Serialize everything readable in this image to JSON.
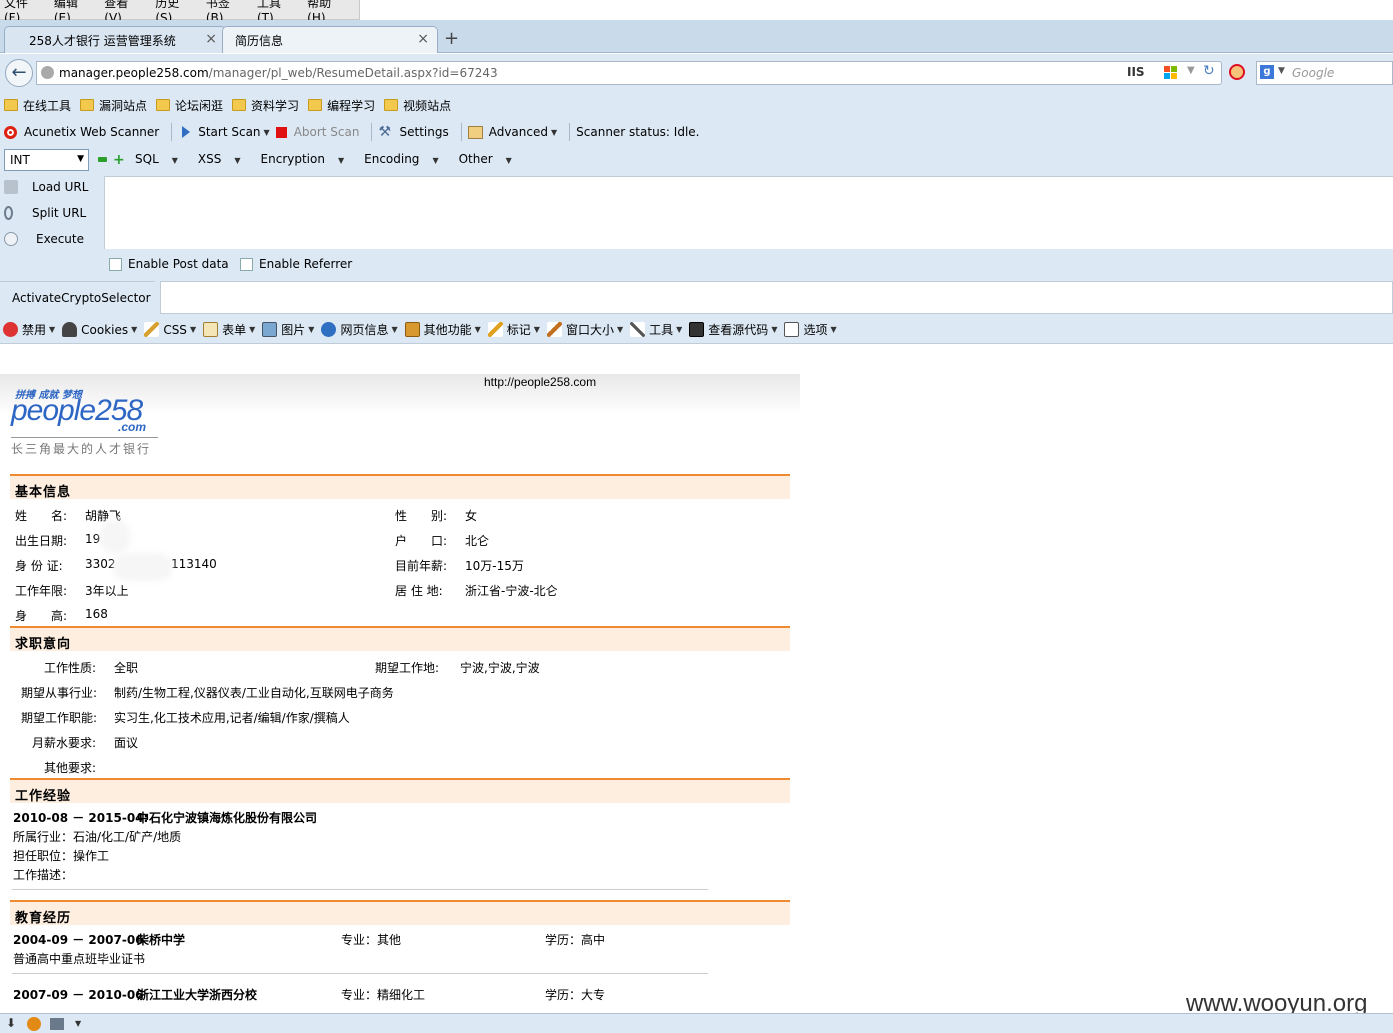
{
  "menu": [
    "文件(F)",
    "编辑(E)",
    "查看(V)",
    "历史(S)",
    "书签(B)",
    "工具(T)",
    "帮助(H)"
  ],
  "tabs": [
    {
      "label": "258人才银行 运营管理系统",
      "close": "×"
    },
    {
      "label": "简历信息",
      "close": "×"
    }
  ],
  "new_tab": "+",
  "nav": {
    "url_host": "manager.people258.com",
    "url_path": "/manager/pl_web/ResumeDetail.aspx?id=67243",
    "url_prefix": "",
    "iis": "IIS",
    "search_placeholder": "Google"
  },
  "bookmarks": [
    "在线工具",
    "漏洞站点",
    "论坛闲逛",
    "资料学习",
    "编程学习",
    "视频站点"
  ],
  "acunetix": {
    "name": "Acunetix Web Scanner",
    "start_scan": "Start Scan",
    "abort_scan": "Abort Scan",
    "settings": "Settings",
    "advanced": "Advanced",
    "status": "Scanner status: Idle."
  },
  "hackbar": {
    "select_value": "INT",
    "menu": [
      "SQL",
      "XSS",
      "Encryption",
      "Encoding",
      "Other"
    ],
    "load_url": "Load URL",
    "split_url": "Split URL",
    "execute": "Execute",
    "enable_post": "Enable Post data",
    "enable_referrer": "Enable Referrer",
    "crypto": "ActivateCryptoSelector"
  },
  "devbar": [
    "禁用",
    "Cookies",
    "CSS",
    "表单",
    "图片",
    "网页信息",
    "其他功能",
    "标记",
    "窗口大小",
    "工具",
    "查看源代码",
    "选项"
  ],
  "page": {
    "site_url": "http://people258.com",
    "logo_tag": "拼搏 成就 梦想",
    "logo_main": "people258",
    "logo_com": ".com",
    "logo_sub": "长三角最大的人才银行",
    "basic": {
      "title": "基本信息",
      "name_label": "姓　　名:",
      "name": "胡静飞",
      "gender_label": "性　　别:",
      "gender": "女",
      "birth_label": "出生日期:",
      "birth": "19",
      "hukou_label": "户　　口:",
      "hukou": "北仑",
      "id_label": "身 份 证:",
      "id_start": "3302",
      "id_end": "113140",
      "salary_label": "目前年薪:",
      "salary": "10万-15万",
      "years_label": "工作年限:",
      "years": "3年以上",
      "residence_label": "居 住 地:",
      "residence": "浙江省-宁波-北仑",
      "height_label": "身　　高:",
      "height": "168"
    },
    "intent": {
      "title": "求职意向",
      "type_label": "工作性质:",
      "type": "全职",
      "place_label": "期望工作地:",
      "place": "宁波,宁波,宁波",
      "industry_label": "期望从事行业:",
      "industry": "制药/生物工程,仪器仪表/工业自动化,互联网电子商务",
      "function_label": "期望工作职能:",
      "function": "实习生,化工技术应用,记者/编辑/作家/撰稿人",
      "pay_label": "月薪水要求:",
      "pay": "面议",
      "other_label": "其他要求:",
      "other": ""
    },
    "work": {
      "title": "工作经验",
      "period": "2010-08 － 2015-04:",
      "company": "中石化宁波镇海炼化股份有限公司",
      "industry": "所属行业：石油/化工/矿产/地质",
      "position": "担任职位：操作工",
      "desc": "工作描述："
    },
    "edu": {
      "title": "教育经历",
      "items": [
        {
          "period": "2004-09 － 2007-06",
          "school": "柴桥中学",
          "major": "专业：其他",
          "degree": "学历：高中",
          "note": "普通高中重点班毕业证书"
        },
        {
          "period": "2007-09 － 2010-06",
          "school": "浙江工业大学浙西分校",
          "major": "专业：精细化工",
          "degree": "学历：大专",
          "note": ""
        }
      ]
    }
  },
  "watermark": "www.wooyun.org",
  "colors": {
    "accent_orange": "#f08a30",
    "section_bg": "#fdeee0",
    "logo_blue": "#2e66c4",
    "toolbar_bg": "#dce8f4"
  }
}
